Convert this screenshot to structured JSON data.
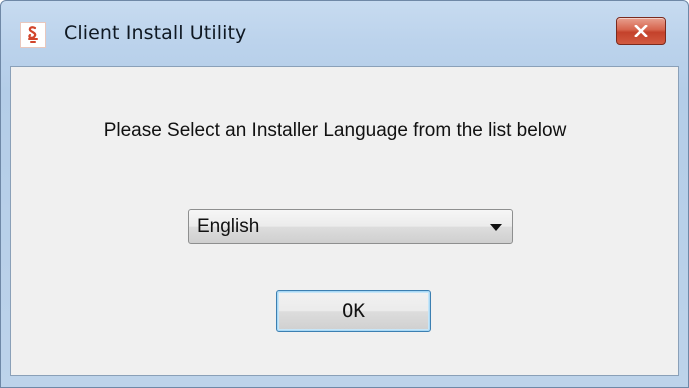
{
  "window": {
    "title": "Client Install Utility",
    "icon": "client-app-icon",
    "close_icon": "close-icon"
  },
  "dialog": {
    "prompt": "Please Select an Installer Language from the list below",
    "language_select": {
      "selected": "English"
    },
    "ok_label": "OK"
  },
  "colors": {
    "title_bar": "#c7dbf0",
    "close_button": "#c3412b",
    "client_background": "#f0f0f0",
    "focus_border": "#3c7fb1"
  }
}
